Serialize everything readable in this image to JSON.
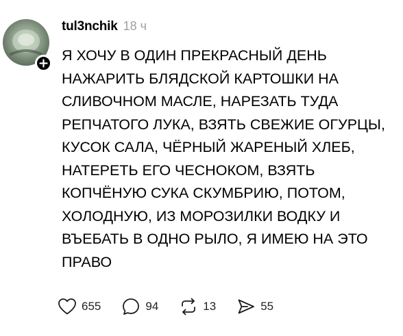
{
  "post": {
    "username": "tul3nchik",
    "time": "18 ч",
    "lines": [
      "Я ХОЧУ В ОДИН ПРЕКРАСНЫЙ ДЕНЬ",
      "НАЖАРИТЬ БЛЯДСКОЙ КАРТОШКИ НА",
      "СЛИВОЧНОМ МАСЛЕ, НАРЕЗАТЬ ТУДА",
      "РЕПЧАТОГО ЛУКА, ВЗЯТЬ СВЕЖИЕ ОГУРЦЫ,",
      "КУСОК САЛА, ЧЁРНЫЙ ЖАРЕНЫЙ ХЛЕБ,",
      "НАТЕРЕТЬ ЕГО ЧЕСНОКОМ, ВЗЯТЬ",
      "КОПЧЁНУЮ СУКА СКУМБРИЮ, ПОТОМ,",
      "ХОЛОДНУЮ, ИЗ МОРОЗИЛКИ ВОДКУ И",
      "ВЪЕБАТЬ В ОДНО РЫЛО, Я ИМЕЮ НА ЭТО",
      "ПРАВО"
    ],
    "actions": {
      "likes": "655",
      "replies": "94",
      "reposts": "13",
      "shares": "55"
    },
    "icons": {
      "like": "heart-icon",
      "reply": "speech-bubble-icon",
      "repost": "repost-arrows-icon",
      "share": "send-icon",
      "follow": "plus-icon"
    }
  }
}
